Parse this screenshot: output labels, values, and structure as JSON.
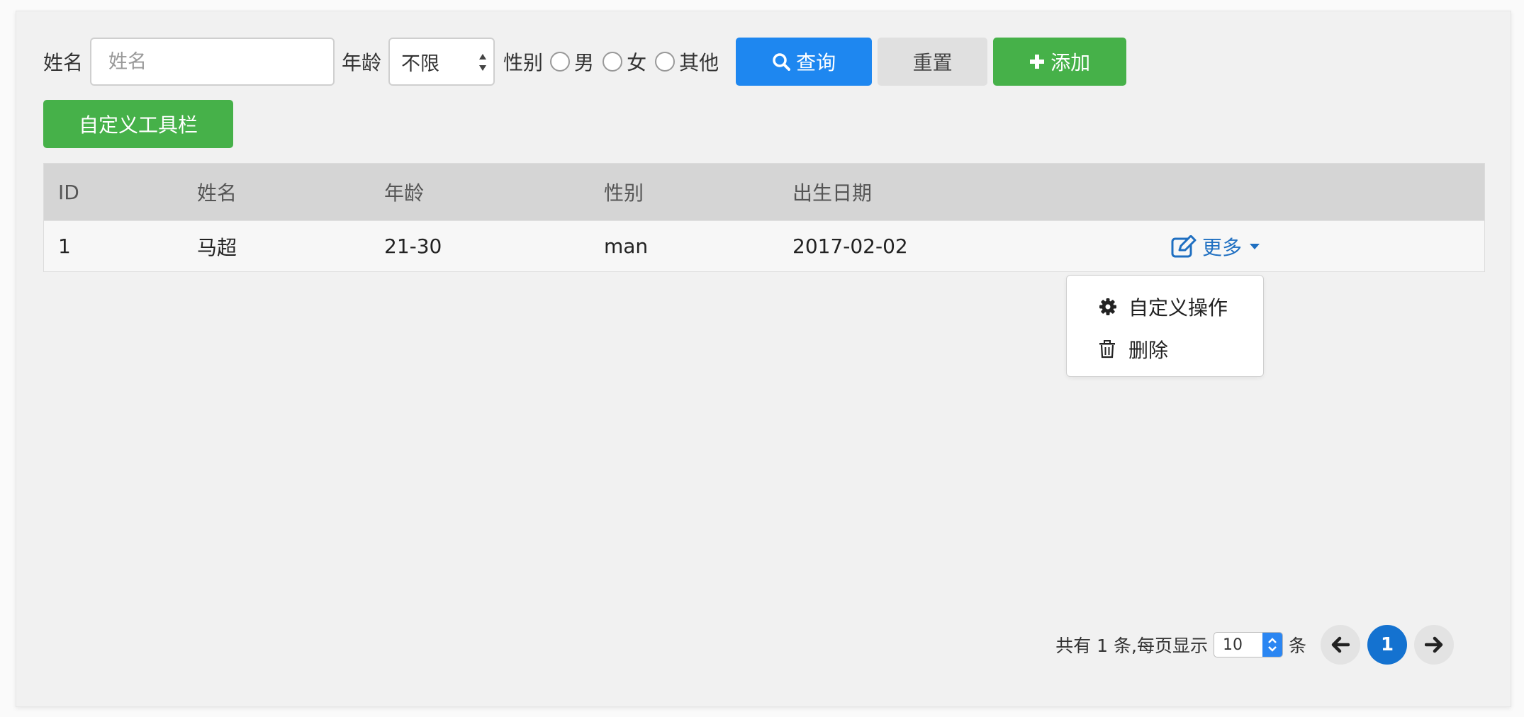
{
  "filters": {
    "name_label": "姓名",
    "name_placeholder": "姓名",
    "age_label": "年龄",
    "age_value": "不限",
    "gender_label": "性别",
    "gender_options": [
      "男",
      "女",
      "其他"
    ],
    "query_label": "查询",
    "reset_label": "重置",
    "add_label": "添加"
  },
  "toolbar": {
    "custom_label": "自定义工具栏"
  },
  "table": {
    "headers": [
      "ID",
      "姓名",
      "年龄",
      "性别",
      "出生日期"
    ],
    "rows": [
      {
        "id": "1",
        "name": "马超",
        "age": "21-30",
        "gender": "man",
        "birth": "2017-02-02",
        "op_label": "更多"
      }
    ]
  },
  "dropdown": {
    "items": [
      {
        "label": "自定义操作",
        "icon": "gear-icon"
      },
      {
        "label": "删除",
        "icon": "trash-icon"
      }
    ]
  },
  "pagination": {
    "total_text": "共有 1 条,每页显示",
    "page_size": "10",
    "unit": "条",
    "current_page": "1"
  },
  "colors": {
    "primary": "#1e87f0",
    "success": "#46b149",
    "link": "#1f6fc1",
    "page_active": "#1472d0"
  }
}
